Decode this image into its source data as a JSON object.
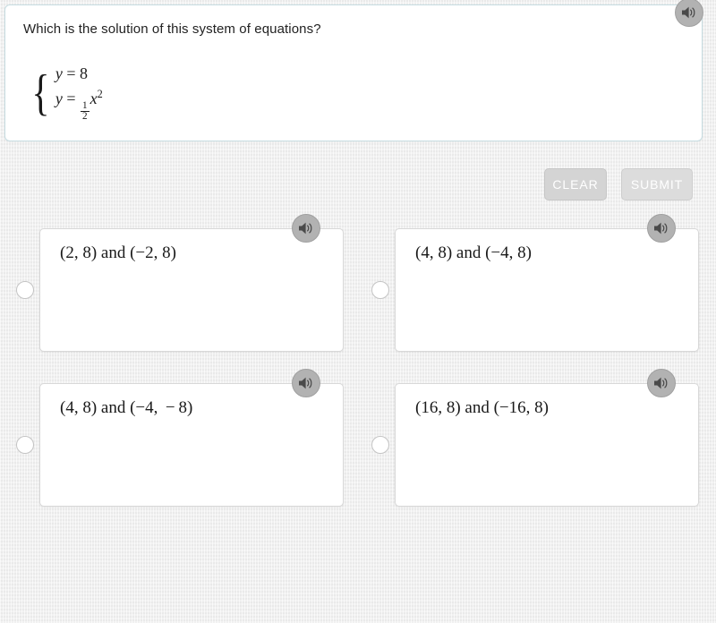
{
  "question": {
    "prompt": "Which is the solution of this system of equations?",
    "system": {
      "line1": {
        "lhs": "y",
        "rel": "=",
        "rhs": "8"
      },
      "line2": {
        "lhs": "y",
        "rel": "=",
        "frac_num": "1",
        "frac_den": "2",
        "var": "x",
        "exponent": "2"
      }
    },
    "audio_icon": "speaker-icon"
  },
  "toolbar": {
    "clear_label": "CLEAR",
    "submit_label": "SUBMIT"
  },
  "options": [
    {
      "id": "option-a",
      "text": "(2, 8) and (−2, 8)",
      "selected": false,
      "audio_icon": "speaker-icon"
    },
    {
      "id": "option-b",
      "text": "(4, 8) and (−4, 8)",
      "selected": false,
      "audio_icon": "speaker-icon"
    },
    {
      "id": "option-c",
      "text": "(4, 8) and (−4,  − 8)",
      "selected": false,
      "audio_icon": "speaker-icon"
    },
    {
      "id": "option-d",
      "text": "(16, 8) and (−16, 8)",
      "selected": false,
      "audio_icon": "speaker-icon"
    }
  ],
  "colors": {
    "page_background": "#eeeeee",
    "card_background": "#ffffff",
    "question_border": "#c7dde2",
    "option_border": "#d8d8d8",
    "button_fill": "#d4d4d4",
    "button_text": "#ffffff",
    "speaker_fill": "#b2b2b2",
    "text": "#1a1a1a"
  }
}
